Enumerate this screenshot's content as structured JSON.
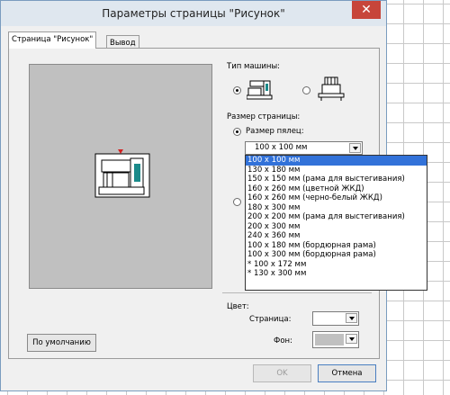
{
  "window": {
    "title": "Параметры страницы \"Рисунок\"",
    "close_glyph": "✕"
  },
  "tabs": [
    {
      "label": "Страница \"Рисунок\"",
      "active": true
    },
    {
      "label": "Вывод",
      "active": false
    }
  ],
  "machine": {
    "label": "Тип машины:",
    "options": [
      {
        "icon": "embroidery-machine-icon",
        "selected": true
      },
      {
        "icon": "multi-needle-machine-icon",
        "selected": false
      }
    ]
  },
  "page_size": {
    "label": "Размер страницы:",
    "hoop_label": "Размер пялец:",
    "selected_value": "100 x 100 мм",
    "options": [
      "100 x 100 мм",
      "130 x 180 мм",
      "150 x 150 мм (рама для выстегивания)",
      "160 x 260 мм (цветной ЖКД)",
      "160 x 260 мм (черно-белый ЖКД)",
      "180 x 300 мм",
      "200 x 200 мм (рама для выстегивания)",
      "200 x 300 мм",
      "240 x 360 мм",
      "100 x 180 мм (бордюрная рама)",
      "100 x 300 мм (бордюрная рама)",
      "* 100 x 172 мм",
      "* 130 x 300 мм"
    ]
  },
  "color": {
    "label": "Цвет:",
    "page_label": "Страница:",
    "background_label": "Фон:",
    "page_color": "#ffffff",
    "background_color": "#c0c0c0"
  },
  "buttons": {
    "default": "По умолчанию",
    "ok": "OK",
    "cancel": "Отмена"
  },
  "colors": {
    "selection": "#3272d9",
    "close_button": "#c7453a",
    "preview_bg": "#c0c0c0",
    "machine_accent": "#1a8a8a",
    "needle_marker": "#d42020"
  }
}
